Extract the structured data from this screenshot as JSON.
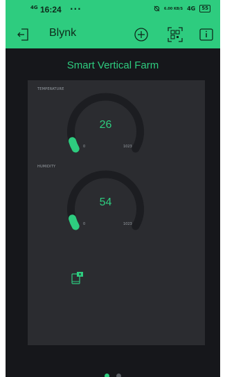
{
  "status_bar": {
    "signal": "4G",
    "time": "16:24",
    "notifications": "···",
    "speed": "6.00 KB/S",
    "network": "4G",
    "battery": "55"
  },
  "app_bar": {
    "title": "Blynk",
    "icons": [
      "exit-icon",
      "add-icon",
      "qr-icon",
      "info-icon"
    ]
  },
  "project": {
    "title": "Smart Vertical Farm"
  },
  "widgets": [
    {
      "label": "TEMPERATURE",
      "value": "26",
      "min": "0",
      "max": "1023",
      "level": 0.025
    },
    {
      "label": "HUMIDITY",
      "value": "54",
      "min": "0",
      "max": "1023",
      "level": 0.053
    }
  ],
  "pager": {
    "count": 2,
    "active": 0
  },
  "colors": {
    "accent": "#2ecc7f",
    "background": "#16171b",
    "canvas": "#2b2c30",
    "track": "#1c1d21"
  }
}
